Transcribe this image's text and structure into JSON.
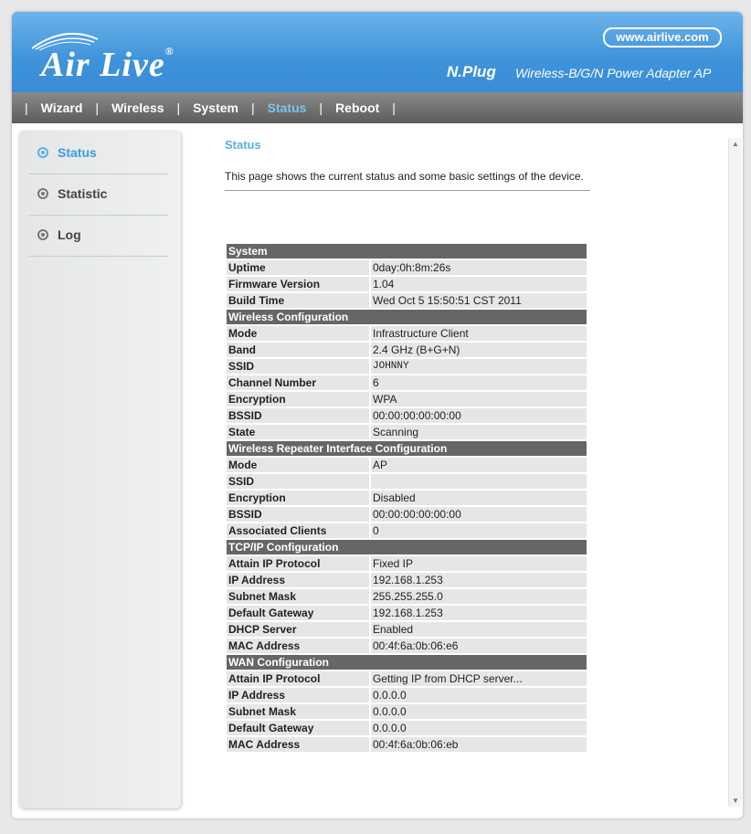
{
  "header": {
    "logo_text": "Air Live",
    "site_url": "www.airlive.com",
    "brand": "N.Plug",
    "product": "Wireless-B/G/N Power Adapter AP"
  },
  "nav": {
    "items": [
      "Wizard",
      "Wireless",
      "System",
      "Status",
      "Reboot"
    ],
    "active": "Status"
  },
  "sidebar": {
    "items": [
      {
        "label": "Status",
        "active": true
      },
      {
        "label": "Statistic",
        "active": false
      },
      {
        "label": "Log",
        "active": false
      }
    ]
  },
  "main": {
    "title": "Status",
    "description": "This page shows the current status and some basic settings of the device."
  },
  "sections": {
    "system": {
      "title": "System",
      "rows": [
        {
          "key": "Uptime",
          "value": "0day:0h:8m:26s"
        },
        {
          "key": "Firmware Version",
          "value": "1.04"
        },
        {
          "key": "Build Time",
          "value": "Wed Oct 5 15:50:51 CST 2011"
        }
      ]
    },
    "wireless": {
      "title": "Wireless Configuration",
      "rows": [
        {
          "key": "Mode",
          "value": "Infrastructure Client"
        },
        {
          "key": "Band",
          "value": "2.4 GHz (B+G+N)"
        },
        {
          "key": "SSID",
          "value": "JOHNNY"
        },
        {
          "key": "Channel Number",
          "value": "6"
        },
        {
          "key": "Encryption",
          "value": "WPA"
        },
        {
          "key": "BSSID",
          "value": "00:00:00:00:00:00"
        },
        {
          "key": "State",
          "value": "Scanning"
        }
      ]
    },
    "repeater": {
      "title": "Wireless Repeater Interface Configuration",
      "rows": [
        {
          "key": "Mode",
          "value": "AP"
        },
        {
          "key": "SSID",
          "value": ""
        },
        {
          "key": "Encryption",
          "value": "Disabled"
        },
        {
          "key": "BSSID",
          "value": "00:00:00:00:00:00"
        },
        {
          "key": "Associated Clients",
          "value": "0"
        }
      ]
    },
    "tcpip": {
      "title": "TCP/IP Configuration",
      "rows": [
        {
          "key": "Attain IP Protocol",
          "value": "Fixed IP"
        },
        {
          "key": "IP Address",
          "value": "192.168.1.253"
        },
        {
          "key": "Subnet Mask",
          "value": "255.255.255.0"
        },
        {
          "key": "Default Gateway",
          "value": "192.168.1.253"
        },
        {
          "key": "DHCP Server",
          "value": "Enabled"
        },
        {
          "key": "MAC Address",
          "value": "00:4f:6a:0b:06:e6"
        }
      ]
    },
    "wan": {
      "title": "WAN Configuration",
      "rows": [
        {
          "key": "Attain IP Protocol",
          "value": "Getting IP from DHCP server..."
        },
        {
          "key": "IP Address",
          "value": "0.0.0.0"
        },
        {
          "key": "Subnet Mask",
          "value": "0.0.0.0"
        },
        {
          "key": "Default Gateway",
          "value": "0.0.0.0"
        },
        {
          "key": "MAC Address",
          "value": "00:4f:6a:0b:06:eb"
        }
      ]
    }
  },
  "colors": {
    "header_blue": "#3e93db",
    "nav_gray": "#5c5c5c",
    "accent": "#5ab0e6",
    "section_bg": "#666666",
    "row_bg": "#e6e6e6"
  }
}
